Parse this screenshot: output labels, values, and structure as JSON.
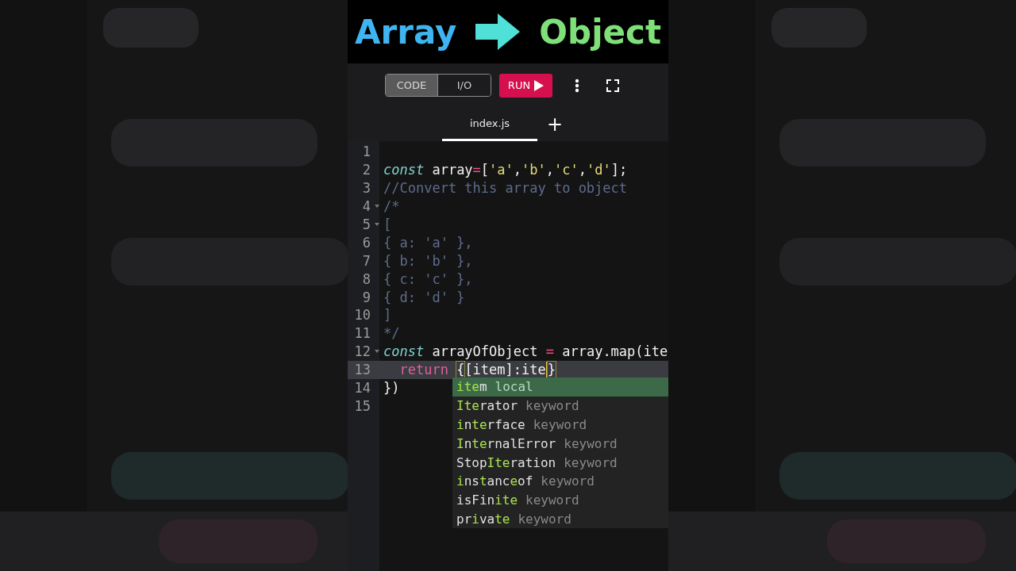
{
  "title": {
    "left": "Array",
    "right": "Object"
  },
  "toolbar": {
    "modes": [
      {
        "label": "CODE",
        "selected": true
      },
      {
        "label": "I/O",
        "selected": false
      }
    ],
    "run": "RUN"
  },
  "tabs": [
    {
      "label": "index.js",
      "selected": true
    }
  ],
  "new_tab": "+",
  "editor": {
    "lines": [
      {
        "number": "1",
        "active": false,
        "foldable": false
      },
      {
        "number": "2",
        "active": false,
        "foldable": false,
        "tokens": [
          {
            "kind": "keyword",
            "text": "const"
          },
          {
            "kind": "plain",
            "text": " array"
          },
          {
            "kind": "operator",
            "text": "="
          },
          {
            "kind": "plain",
            "text": "["
          },
          {
            "kind": "string",
            "text": "'a'"
          },
          {
            "kind": "plain",
            "text": ","
          },
          {
            "kind": "string",
            "text": "'b'"
          },
          {
            "kind": "plain",
            "text": ","
          },
          {
            "kind": "string",
            "text": "'c'"
          },
          {
            "kind": "plain",
            "text": ","
          },
          {
            "kind": "string",
            "text": "'d'"
          },
          {
            "kind": "plain",
            "text": "];"
          }
        ]
      },
      {
        "number": "3",
        "active": false,
        "foldable": false,
        "tokens": [
          {
            "kind": "comment",
            "text": "//Convert this array to object"
          }
        ]
      },
      {
        "number": "4",
        "active": false,
        "foldable": true,
        "tokens": [
          {
            "kind": "comment",
            "text": "/*"
          }
        ]
      },
      {
        "number": "5",
        "active": false,
        "foldable": true,
        "tokens": [
          {
            "kind": "comment",
            "text": "["
          }
        ]
      },
      {
        "number": "6",
        "active": false,
        "foldable": false,
        "tokens": [
          {
            "kind": "comment",
            "text": "{ a: 'a' },"
          }
        ]
      },
      {
        "number": "7",
        "active": false,
        "foldable": false,
        "tokens": [
          {
            "kind": "comment",
            "text": "{ b: 'b' },"
          }
        ]
      },
      {
        "number": "8",
        "active": false,
        "foldable": false,
        "tokens": [
          {
            "kind": "comment",
            "text": "{ c: 'c' },"
          }
        ]
      },
      {
        "number": "9",
        "active": false,
        "foldable": false,
        "tokens": [
          {
            "kind": "comment",
            "text": "{ d: 'd' }"
          }
        ]
      },
      {
        "number": "10",
        "active": false,
        "foldable": false,
        "tokens": [
          {
            "kind": "comment",
            "text": "]"
          }
        ]
      },
      {
        "number": "11",
        "active": false,
        "foldable": false,
        "tokens": [
          {
            "kind": "comment",
            "text": "*/"
          }
        ]
      },
      {
        "number": "12",
        "active": false,
        "foldable": true,
        "tokens": [
          {
            "kind": "keyword",
            "text": "const"
          },
          {
            "kind": "plain",
            "text": " arrayOfObject "
          },
          {
            "kind": "operator",
            "text": "="
          },
          {
            "kind": "plain",
            "text": " array.map(ite"
          }
        ]
      },
      {
        "number": "13",
        "active": true,
        "foldable": false,
        "tokens": [
          {
            "kind": "control",
            "text": "  return "
          },
          {
            "kind": "bracket",
            "text": "{"
          },
          {
            "kind": "plain",
            "text": "[item]:ite",
            "cursor_after": true
          },
          {
            "kind": "bracket",
            "text": "}"
          }
        ]
      },
      {
        "number": "14",
        "active": false,
        "foldable": false,
        "tokens": [
          {
            "kind": "plain",
            "text": "})"
          }
        ]
      },
      {
        "number": "15",
        "active": false,
        "foldable": false
      }
    ]
  },
  "suggestions": [
    {
      "selected": true,
      "parts": [
        {
          "text": "ite",
          "match": true
        },
        {
          "text": "m",
          "match": false
        }
      ],
      "type": "local"
    },
    {
      "selected": false,
      "parts": [
        {
          "text": "Ite",
          "match": true
        },
        {
          "text": "rator",
          "match": false
        }
      ],
      "type": "keyword"
    },
    {
      "selected": false,
      "parts": [
        {
          "text": "i",
          "match": true
        },
        {
          "text": "n",
          "match": false
        },
        {
          "text": "t",
          "match": true
        },
        {
          "text": "e",
          "match": true
        },
        {
          "text": "rface",
          "match": false
        }
      ],
      "type": "keyword"
    },
    {
      "selected": false,
      "parts": [
        {
          "text": "I",
          "match": true
        },
        {
          "text": "n",
          "match": false
        },
        {
          "text": "te",
          "match": true
        },
        {
          "text": "rnalError",
          "match": false
        }
      ],
      "type": "keyword"
    },
    {
      "selected": false,
      "parts": [
        {
          "text": "Stop",
          "match": false
        },
        {
          "text": "Ite",
          "match": true
        },
        {
          "text": "ration",
          "match": false
        }
      ],
      "type": "keyword"
    },
    {
      "selected": false,
      "parts": [
        {
          "text": "i",
          "match": true
        },
        {
          "text": "ns",
          "match": false
        },
        {
          "text": "t",
          "match": true
        },
        {
          "text": "anc",
          "match": false
        },
        {
          "text": "e",
          "match": true
        },
        {
          "text": "of",
          "match": false
        }
      ],
      "type": "keyword"
    },
    {
      "selected": false,
      "parts": [
        {
          "text": "isFin",
          "match": false
        },
        {
          "text": "ite",
          "match": true
        }
      ],
      "type": "keyword"
    },
    {
      "selected": false,
      "parts": [
        {
          "text": "pr",
          "match": false
        },
        {
          "text": "i",
          "match": true
        },
        {
          "text": "va",
          "match": false
        },
        {
          "text": "te",
          "match": true
        }
      ],
      "type": "keyword"
    }
  ]
}
